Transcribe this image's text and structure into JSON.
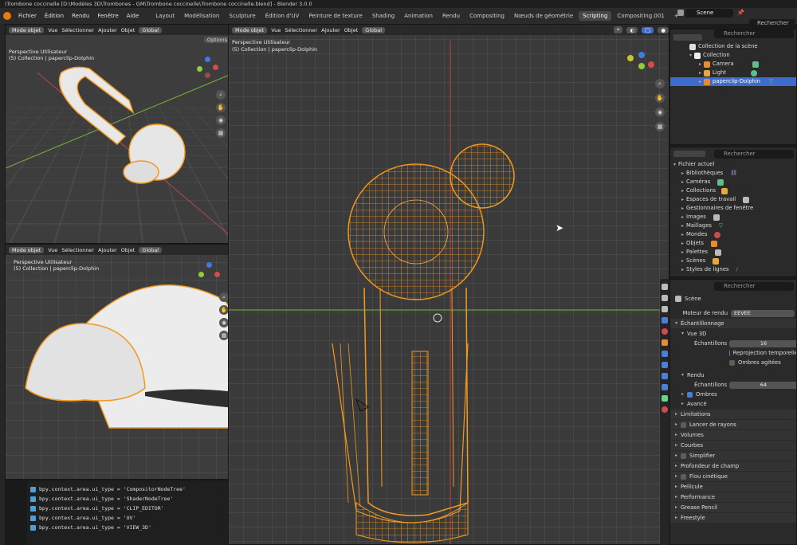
{
  "window_title": "\\Trombone coccinelle [D:\\Modèles 3D\\Trombones - GM\\Trombone coccinelle\\Trombone coccinelle.blend] - Blender 3.0.0",
  "menus": [
    "Fichier",
    "Édition",
    "Rendu",
    "Fenêtre",
    "Aide"
  ],
  "workspaces": [
    "Layout",
    "Modélisation",
    "Sculpture",
    "Édition d'UV",
    "Peinture de texture",
    "Shading",
    "Animation",
    "Rendu",
    "Compositing",
    "Nœuds de géométrie",
    "Scripting",
    "Compositing.001"
  ],
  "active_workspace": "Scripting",
  "add_tab": "+",
  "scene": {
    "name": "Scene",
    "view_layer_search": "Rechercher"
  },
  "viewport_header": {
    "mode": "Mode objet",
    "view": "Vue",
    "select": "Sélectionner",
    "add": "Ajouter",
    "object": "Objet",
    "transform": "Global",
    "options": "Options"
  },
  "viewports": [
    {
      "id": "top-left",
      "perspective": "Perspective Utilisateur",
      "collection": "(5) Collection | paperclip-Dolphin"
    },
    {
      "id": "main",
      "perspective": "Perspective Utilisateur",
      "collection": "(5) Collection | paperclip-Dolphin"
    },
    {
      "id": "bottom-left",
      "perspective": "Perspective Utilisateur",
      "collection": "(5) Collection | paperclip-Dolphin"
    }
  ],
  "outliner": {
    "search_placeholder": "Rechercher",
    "root": "Collection de la scène",
    "items": [
      {
        "label": "Collection",
        "level": 1
      },
      {
        "label": "Camera",
        "level": 2
      },
      {
        "label": "Light",
        "level": 2
      },
      {
        "label": "paperclip-Dolphin",
        "level": 2,
        "selected": true
      }
    ]
  },
  "file_browser": {
    "search_placeholder": "Rechercher",
    "root": "Fichier actuel",
    "items": [
      "Bibliothèques",
      "Caméras",
      "Collections",
      "Espaces de travail",
      "Gestionnaires de fenêtre",
      "Images",
      "Maillages",
      "Mondes",
      "Objets",
      "Palettes",
      "Scènes",
      "Styles de lignes"
    ]
  },
  "properties": {
    "search_placeholder": "Rechercher",
    "scene_label": "Scène",
    "render_engine_label": "Moteur de rendu",
    "render_engine_value": "EEVEE",
    "sampling": "Échantillonnage",
    "viewport_3d": "Vue 3D",
    "samples_label": "Échantillons",
    "viewport_samples": "16",
    "reprojection": "Reprojection temporelle",
    "shadows_soft": "Ombres agitées",
    "render": "Rendu",
    "render_samples": "64",
    "shadows": "Ombres",
    "advanced": "Avancé",
    "sections": [
      "Limitations",
      "Lancer de rayons",
      "Volumes",
      "Courbes",
      "Simplifier",
      "Profondeur de champ",
      "Flou cinétique",
      "Pellicule",
      "Performance",
      "Grease Pencil",
      "Freestyle"
    ]
  },
  "console": {
    "lines": [
      "bpy.context.area.ui_type = 'CompositorNodeTree'",
      "bpy.context.area.ui_type = 'ShaderNodeTree'",
      "bpy.context.area.ui_type = 'CLIP_EDITOR'",
      "bpy.context.area.ui_type = 'UV'",
      "bpy.context.area.ui_type = 'VIEW_3D'"
    ]
  },
  "colors": {
    "accent": "#e87d0d",
    "selection": "#3e6ccd",
    "wire": "#f39a1e",
    "axis_x": "#d94a4a",
    "axis_y": "#8ccf3b"
  }
}
